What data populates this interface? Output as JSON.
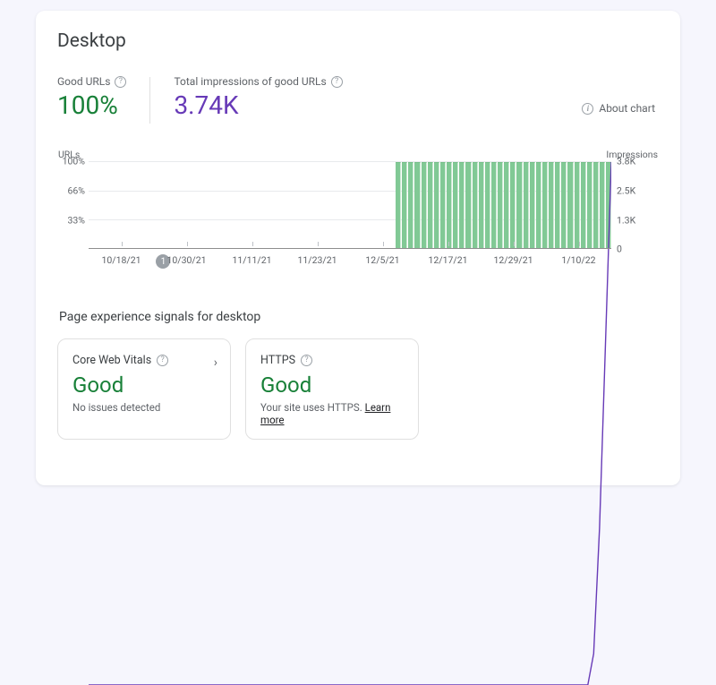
{
  "title": "Desktop",
  "stats": {
    "good_urls_label": "Good URLs",
    "good_urls_value": "100%",
    "impressions_label": "Total impressions of good URLs",
    "impressions_value": "3.74K"
  },
  "about_chart_label": "About chart",
  "chart_data": {
    "type": "bar+line",
    "left_axis_title": "URLs",
    "right_axis_title": "Impressions",
    "left_ticks": [
      "100%",
      "66%",
      "33%"
    ],
    "right_ticks": [
      "3.8K",
      "2.5K",
      "1.3K",
      "0"
    ],
    "x_ticks": [
      "10/18/21",
      "10/30/21",
      "11/11/21",
      "11/23/21",
      "12/5/21",
      "12/17/21",
      "12/29/21",
      "1/10/22"
    ],
    "annotation": {
      "x_index": 1,
      "label": "1"
    },
    "bars_series": {
      "name": "Good URLs %",
      "total_points": 90,
      "start_nonzero_index": 56,
      "value_after_start_pct": 100
    },
    "line_series": {
      "name": "Impressions",
      "points_pct_of_max": [
        0,
        0,
        0,
        0,
        0,
        0,
        0,
        0,
        0,
        0,
        0,
        0,
        0,
        0,
        0,
        0,
        0,
        0,
        0,
        0,
        0,
        0,
        0,
        0,
        0,
        0,
        0,
        0,
        0,
        0,
        0,
        0,
        0,
        0,
        0,
        0,
        0,
        0,
        0,
        0,
        0,
        0,
        0,
        0,
        0,
        0,
        0,
        0,
        0,
        0,
        0,
        0,
        0,
        0,
        0,
        0,
        0,
        0,
        0,
        0,
        0,
        0,
        0,
        0,
        0,
        0,
        0,
        0,
        0,
        0,
        0,
        0,
        0,
        0,
        0,
        0,
        0,
        0,
        0,
        0,
        0,
        0,
        0,
        0,
        0,
        0,
        6,
        30,
        65,
        100
      ]
    }
  },
  "signals_heading": "Page experience signals for desktop",
  "signals": {
    "cwv": {
      "title": "Core Web Vitals",
      "status": "Good",
      "sub": "No issues detected"
    },
    "https": {
      "title": "HTTPS",
      "status": "Good",
      "sub_prefix": "Your site uses HTTPS. ",
      "learn_more": "Learn more"
    }
  }
}
